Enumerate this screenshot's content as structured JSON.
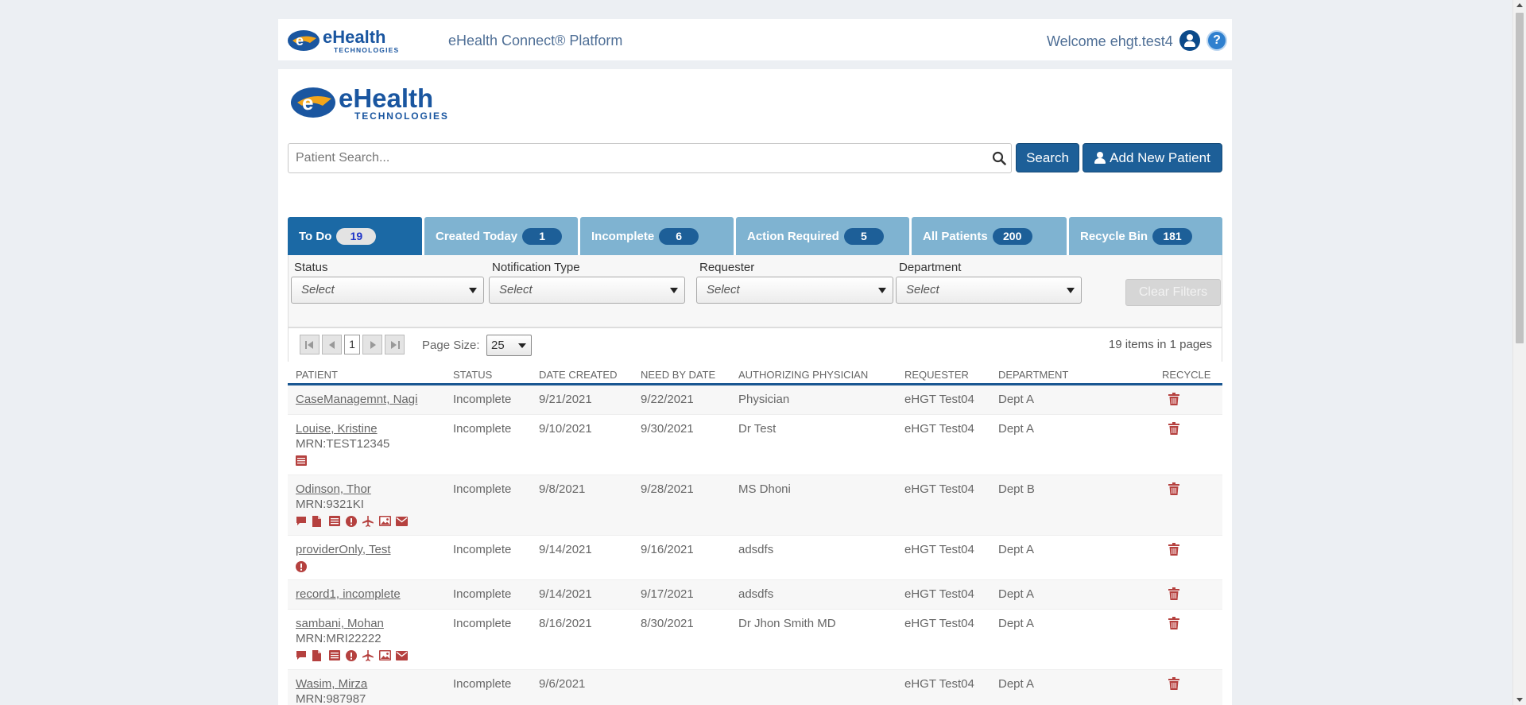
{
  "header": {
    "platform_title": "eHealth Connect® Platform",
    "welcome": "Welcome ehgt.test4",
    "help_glyph": "?"
  },
  "logo": {
    "brand": "eHealth",
    "sub": "TECHNOLOGIES",
    "brand_color": "#1a56a0",
    "accent_color": "#f2a51a"
  },
  "search": {
    "placeholder": "Patient Search...",
    "value": "",
    "search_label": "Search",
    "add_label": "Add New Patient"
  },
  "tabs": [
    {
      "label": "To Do",
      "count": "19",
      "active": true
    },
    {
      "label": "Created Today",
      "count": "1",
      "active": false
    },
    {
      "label": "Incomplete",
      "count": "6",
      "active": false
    },
    {
      "label": "Action Required",
      "count": "5",
      "active": false
    },
    {
      "label": "All Patients",
      "count": "200",
      "active": false
    },
    {
      "label": "Recycle Bin",
      "count": "181",
      "active": false
    }
  ],
  "filters": {
    "status": {
      "label": "Status",
      "value": "Select"
    },
    "notification_type": {
      "label": "Notification Type",
      "value": "Select"
    },
    "requester": {
      "label": "Requester",
      "value": "Select"
    },
    "department": {
      "label": "Department",
      "value": "Select"
    },
    "clear_label": "Clear Filters"
  },
  "pager": {
    "page": "1",
    "page_size_label": "Page Size:",
    "page_size": "25",
    "items_info": "19 items in 1 pages"
  },
  "table": {
    "columns": [
      "PATIENT",
      "STATUS",
      "DATE CREATED",
      "NEED BY DATE",
      "AUTHORIZING PHYSICIAN",
      "REQUESTER",
      "DEPARTMENT",
      "RECYCLE"
    ],
    "rows": [
      {
        "name": "CaseManagemnt, Nagi",
        "mrn": "",
        "icons": [],
        "status": "Incomplete",
        "created": "9/21/2021",
        "need_by": "9/22/2021",
        "physician": "Physician",
        "requester": "eHGT Test04",
        "department": "Dept A"
      },
      {
        "name": "Louise, Kristine",
        "mrn": "MRN:TEST12345",
        "icons": [
          "list-icon"
        ],
        "status": "Incomplete",
        "created": "9/10/2021",
        "need_by": "9/30/2021",
        "physician": "Dr Test",
        "requester": "eHGT Test04",
        "department": "Dept A"
      },
      {
        "name": "Odinson, Thor",
        "mrn": "MRN:9321KI",
        "icons": [
          "comment-icon",
          "document-icon",
          "list-icon",
          "alert-icon",
          "plane-icon",
          "image-icon",
          "envelope-icon"
        ],
        "status": "Incomplete",
        "created": "9/8/2021",
        "need_by": "9/28/2021",
        "physician": "MS Dhoni",
        "requester": "eHGT Test04",
        "department": "Dept B"
      },
      {
        "name": "providerOnly, Test",
        "mrn": "",
        "icons": [
          "alert-icon"
        ],
        "status": "Incomplete",
        "created": "9/14/2021",
        "need_by": "9/16/2021",
        "physician": "adsdfs",
        "requester": "eHGT Test04",
        "department": "Dept A"
      },
      {
        "name": "record1, incomplete",
        "mrn": "",
        "icons": [],
        "status": "Incomplete",
        "created": "9/14/2021",
        "need_by": "9/17/2021",
        "physician": "adsdfs",
        "requester": "eHGT Test04",
        "department": "Dept A"
      },
      {
        "name": "sambani, Mohan",
        "mrn": "MRN:MRI22222",
        "icons": [
          "comment-icon",
          "document-icon",
          "list-icon",
          "alert-icon",
          "plane-icon",
          "image-icon",
          "envelope-icon"
        ],
        "status": "Incomplete",
        "created": "8/16/2021",
        "need_by": "8/30/2021",
        "physician": "Dr Jhon Smith MD",
        "requester": "eHGT Test04",
        "department": "Dept A"
      },
      {
        "name": "Wasim, Mirza",
        "mrn": "MRN:987987",
        "icons": [],
        "status": "Incomplete",
        "created": "9/6/2021",
        "need_by": "",
        "physician": "",
        "requester": "eHGT Test04",
        "department": "Dept A"
      }
    ]
  },
  "colors": {
    "primary": "#1d5f98",
    "tab_inactive": "#7fb3d1",
    "tab_active": "#1b69a5",
    "icon_red": "#b5413f"
  }
}
